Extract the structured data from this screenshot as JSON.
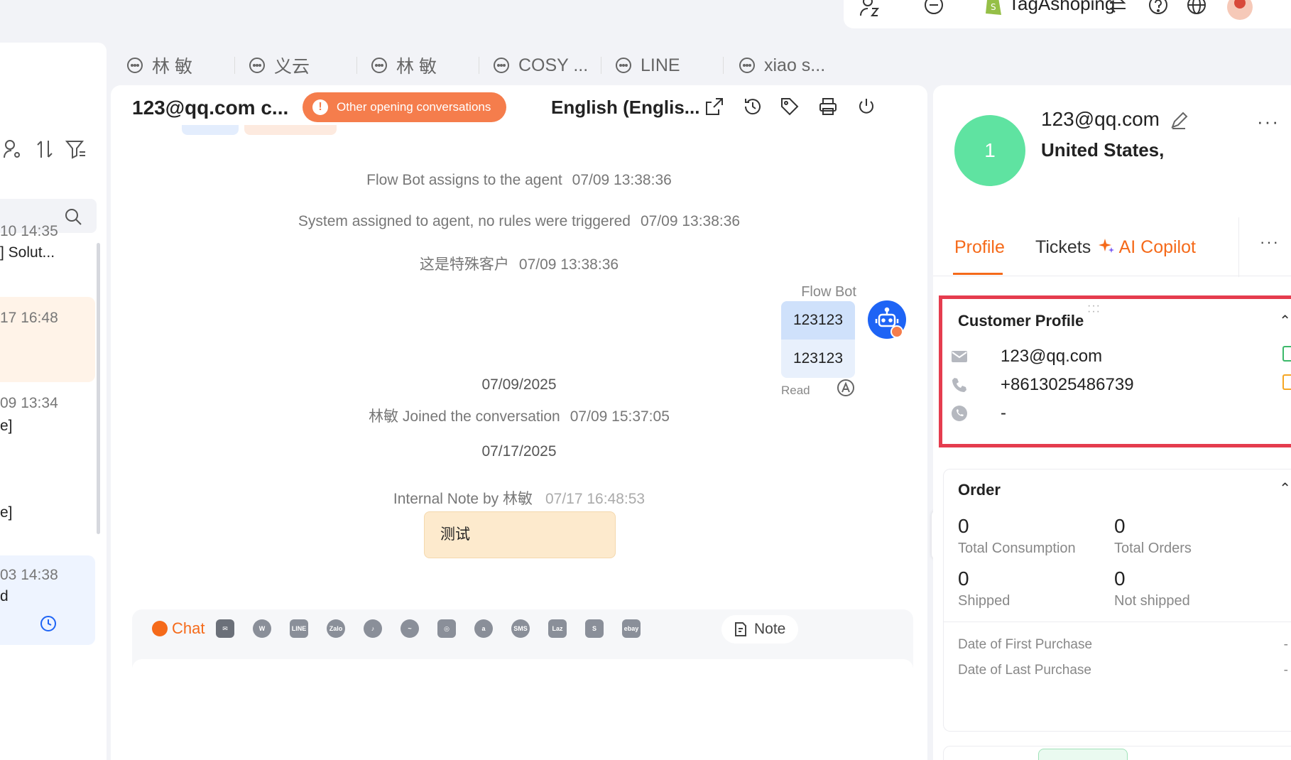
{
  "header": {
    "shop_name": "TagAshoping"
  },
  "left_list": {
    "items": [
      {
        "time": "10 14:35",
        "preview": "] Solut..."
      },
      {
        "time": "17 16:48",
        "preview": ""
      },
      {
        "time": "09 13:34",
        "preview": "e]"
      },
      {
        "time": "",
        "preview": "e]"
      },
      {
        "time": "03 14:38",
        "preview": "d"
      }
    ]
  },
  "conversation_tabs": [
    {
      "label": "林 敏"
    },
    {
      "label": "义云"
    },
    {
      "label": "林 敏"
    },
    {
      "label": "COSY ..."
    },
    {
      "label": "LINE"
    },
    {
      "label": "xiao s..."
    }
  ],
  "chat": {
    "title": "123@qq.com c...",
    "other_conversations_label": "Other opening conversations",
    "language": "English (Englis...",
    "messages": {
      "sys1_text": "Flow Bot assigns to the agent",
      "sys1_time": "07/09 13:38:36",
      "sys2_text": "System assigned to agent, no rules were triggered",
      "sys2_time": "07/09 13:38:36",
      "sys3_text": "这是特殊客户",
      "sys3_time": "07/09 13:38:36",
      "bot_name": "Flow Bot",
      "bubble1": "123123",
      "bubble2": "123123",
      "read": "Read",
      "date1": "07/09/2025",
      "joined_text": "林敏 Joined the conversation",
      "joined_time": "07/09 15:37:05",
      "date2": "07/17/2025",
      "note_by": "Internal Note by 林敏",
      "note_time": "07/17 16:48:53",
      "note_text": "测试"
    },
    "composer": {
      "mode_label": "Chat",
      "note_label": "Note"
    }
  },
  "customer": {
    "avatar_initial": "1",
    "email": "123@qq.com",
    "country": "United States,",
    "tabs": {
      "profile": "Profile",
      "tickets": "Tickets",
      "copilot": "AI Copilot"
    },
    "profile_section": {
      "title": "Customer Profile",
      "email": "123@qq.com",
      "phone": "+8613025486739",
      "whatsapp": "-"
    },
    "order_section": {
      "title": "Order",
      "total_consumption_value": "0",
      "total_consumption_label": "Total Consumption",
      "total_orders_value": "0",
      "total_orders_label": "Total Orders",
      "shipped_value": "0",
      "shipped_label": "Shipped",
      "not_shipped_value": "0",
      "not_shipped_label": "Not shipped",
      "first_purchase_label": "Date of First Purchase",
      "first_purchase_value": "-",
      "last_purchase_label": "Date of Last Purchase",
      "last_purchase_value": "-"
    }
  },
  "colors": {
    "accent": "#f56a1a",
    "highlight_border": "#e53c4e",
    "avatar_green": "#5fe3a1",
    "bot_blue": "#1e64f5"
  }
}
